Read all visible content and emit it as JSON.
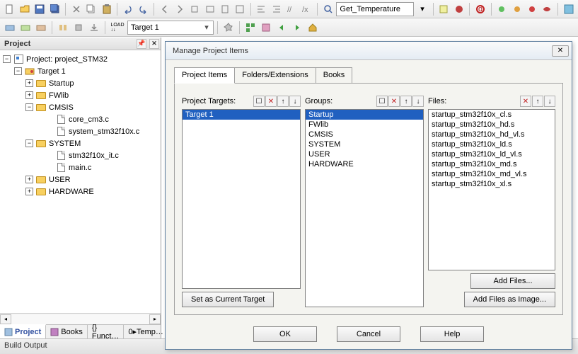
{
  "toolbar1": {
    "search_box": "Get_Temperature"
  },
  "toolbar2": {
    "target_select": "Target 1",
    "loop_label": "LOAD"
  },
  "project_panel": {
    "title": "Project",
    "root": "Project: project_STM32",
    "target": "Target 1",
    "groups": [
      {
        "name": "Startup",
        "expanded": false,
        "files": []
      },
      {
        "name": "FWlib",
        "expanded": false,
        "files": []
      },
      {
        "name": "CMSIS",
        "expanded": true,
        "files": [
          "core_cm3.c",
          "system_stm32f10x.c"
        ]
      },
      {
        "name": "SYSTEM",
        "expanded": true,
        "files": [
          "stm32f10x_it.c",
          "main.c"
        ]
      },
      {
        "name": "USER",
        "expanded": false,
        "files": []
      },
      {
        "name": "HARDWARE",
        "expanded": false,
        "files": []
      }
    ],
    "tabs": [
      "Project",
      "Books",
      "{} Funct…",
      "0▸Temp…"
    ]
  },
  "build_output": {
    "label": "Build Output"
  },
  "dialog": {
    "title": "Manage Project Items",
    "tabs": [
      "Project Items",
      "Folders/Extensions",
      "Books"
    ],
    "col1": {
      "label": "Project Targets:",
      "items": [
        "Target 1"
      ],
      "btn": "Set as Current Target"
    },
    "col2": {
      "label": "Groups:",
      "items": [
        "Startup",
        "FWlib",
        "CMSIS",
        "SYSTEM",
        "USER",
        "HARDWARE"
      ]
    },
    "col3": {
      "label": "Files:",
      "items": [
        "startup_stm32f10x_cl.s",
        "startup_stm32f10x_hd.s",
        "startup_stm32f10x_hd_vl.s",
        "startup_stm32f10x_ld.s",
        "startup_stm32f10x_ld_vl.s",
        "startup_stm32f10x_md.s",
        "startup_stm32f10x_md_vl.s",
        "startup_stm32f10x_xl.s"
      ],
      "btn1": "Add Files...",
      "btn2": "Add Files as Image..."
    },
    "footer": {
      "ok": "OK",
      "cancel": "Cancel",
      "help": "Help"
    }
  }
}
